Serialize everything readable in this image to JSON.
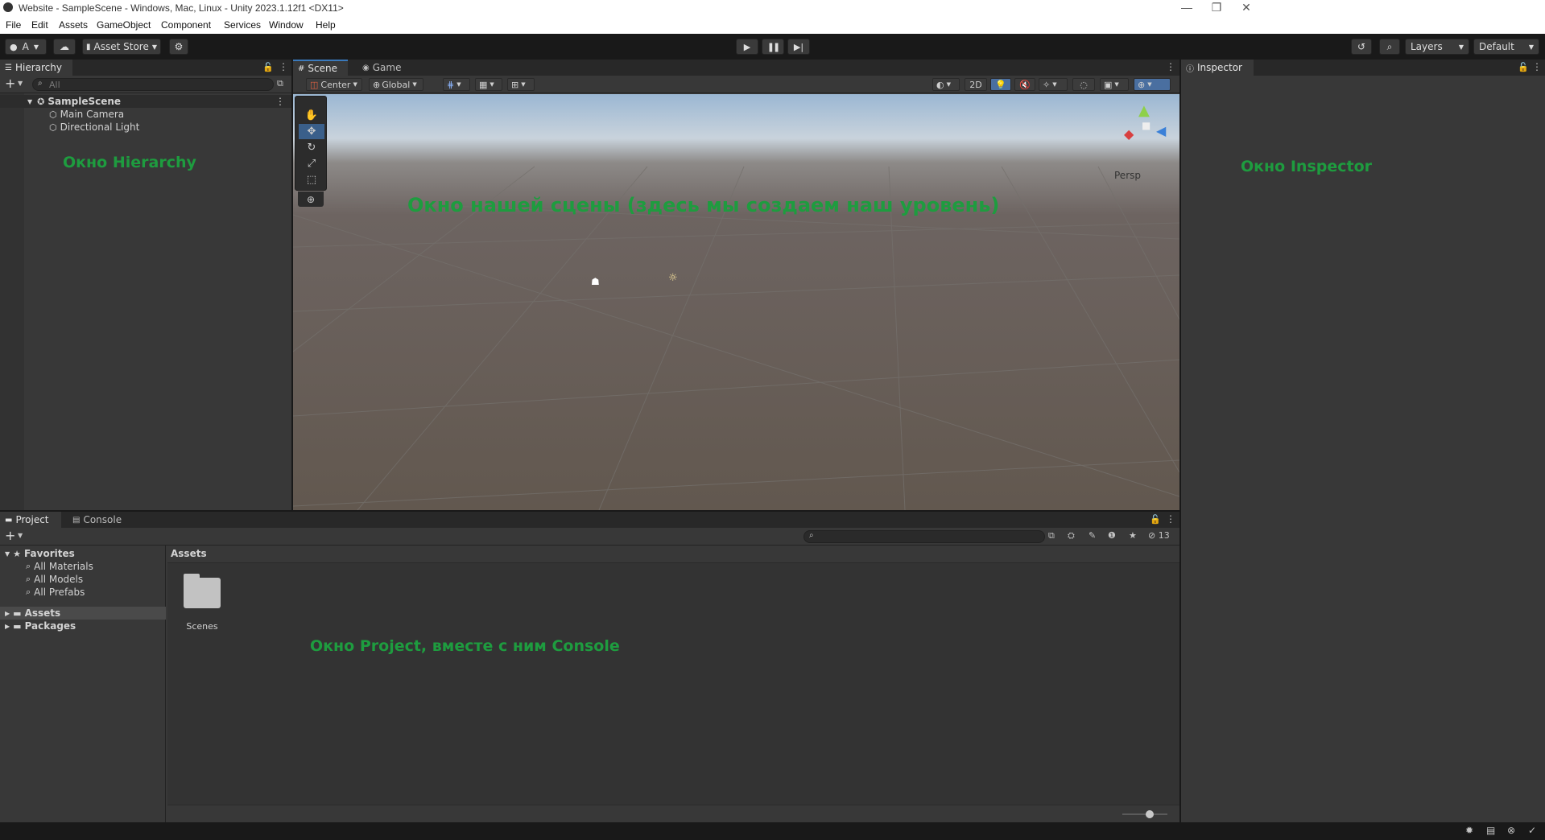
{
  "window": {
    "title": "Website - SampleScene - Windows, Mac, Linux - Unity 2023.1.12f1 <DX11>",
    "minimize": "—",
    "restore": "❐",
    "close": "✕"
  },
  "menu": [
    "File",
    "Edit",
    "Assets",
    "GameObject",
    "Component",
    "Services",
    "Window",
    "Help"
  ],
  "toolbar": {
    "account": "A",
    "asset_store": "Asset Store",
    "layers": "Layers",
    "layout": "Default"
  },
  "hierarchy": {
    "tab": "Hierarchy",
    "search_placeholder": "All",
    "scene": "SampleScene",
    "items": [
      "Main Camera",
      "Directional Light"
    ],
    "note": "Окно Hierarchy"
  },
  "scene_view": {
    "tabs": [
      "Scene",
      "Game"
    ],
    "pivot": "Center",
    "space": "Global",
    "mode_2d": "2D",
    "persp": "Persp",
    "note": "Окно нашей сцены (здесь мы создаем наш уровень)"
  },
  "inspector": {
    "tab": "Inspector",
    "note": "Окно Inspector"
  },
  "project": {
    "tabs": [
      "Project",
      "Console"
    ],
    "favorites_label": "Favorites",
    "favorites": [
      "All Materials",
      "All Models",
      "All Prefabs"
    ],
    "roots": [
      "Assets",
      "Packages"
    ],
    "breadcrumb": "Assets",
    "folders": [
      "Scenes"
    ],
    "hidden_count": "13",
    "zoom": 0.6,
    "note": "Окно Project, вместе с ним Console"
  },
  "colors": {
    "accent": "#3a79bb",
    "note": "#1e9c3f",
    "panel": "#383838",
    "tabbar": "#282828"
  }
}
